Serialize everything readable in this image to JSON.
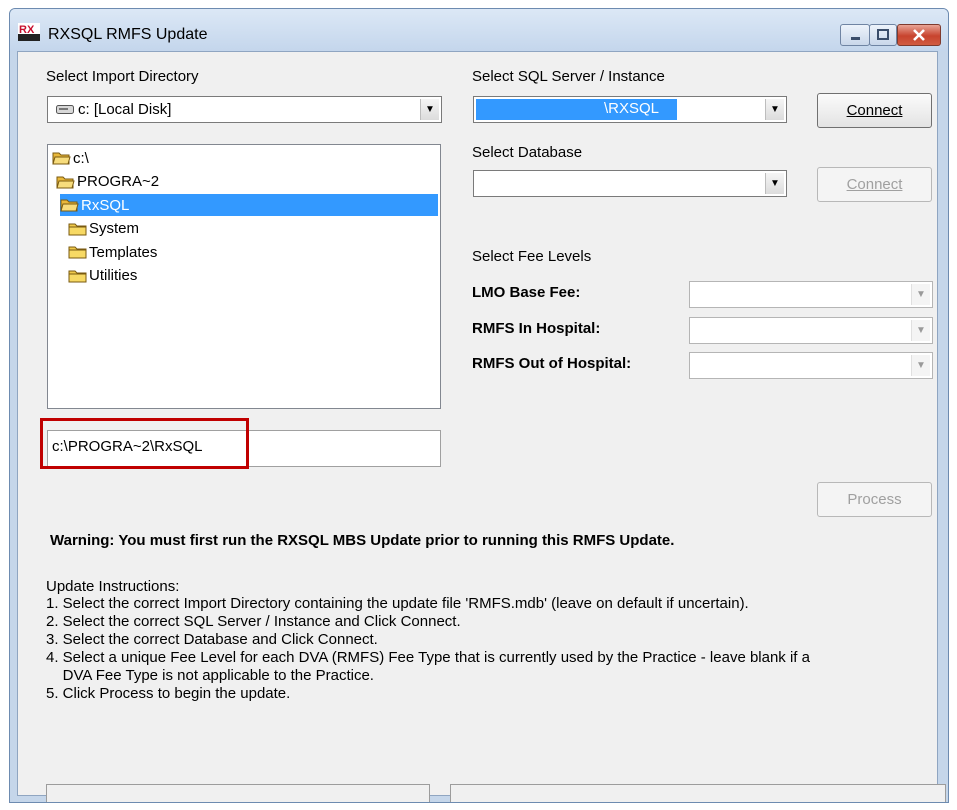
{
  "window": {
    "title": "RXSQL RMFS Update",
    "logo_text": "RX"
  },
  "import_dir": {
    "label": "Select Import Directory",
    "drive_value": "c: [Local Disk]",
    "tree": [
      {
        "name": "c:\\",
        "selected": false
      },
      {
        "name": "PROGRA~2",
        "selected": false
      },
      {
        "name": "RxSQL",
        "selected": true
      },
      {
        "name": "System",
        "selected": false
      },
      {
        "name": "Templates",
        "selected": false
      },
      {
        "name": "Utilities",
        "selected": false
      }
    ],
    "path_value": "c:\\PROGRA~2\\RxSQL"
  },
  "server": {
    "label": "Select SQL Server / Instance",
    "value": "\\RXSQL",
    "connect_label": "Connect"
  },
  "database": {
    "label": "Select Database",
    "value": "",
    "connect_label": "Connect"
  },
  "fees": {
    "label": "Select Fee Levels",
    "lmo_label": "LMO Base Fee:",
    "in_hospital_label": "RMFS In Hospital:",
    "out_hospital_label": "RMFS Out of Hospital:"
  },
  "process_label": "Process",
  "warning": "Warning: You must first run the RXSQL MBS Update prior to running this RMFS Update.",
  "instructions": {
    "heading": "Update Instructions:",
    "lines": [
      "1. Select the correct Import Directory containing the update file 'RMFS.mdb' (leave on default if uncertain).",
      "2. Select the correct SQL Server / Instance and Click Connect.",
      "3. Select the correct Database and Click Connect.",
      "4. Select a unique Fee Level for each DVA (RMFS) Fee Type that is currently used by the Practice - leave blank if a",
      "    DVA Fee Type is not applicable to the Practice.",
      "5. Click Process to begin the update."
    ]
  },
  "colors": {
    "highlight": "#3399ff",
    "annotation_box": "#c00000",
    "folder": "#f0c94a"
  }
}
